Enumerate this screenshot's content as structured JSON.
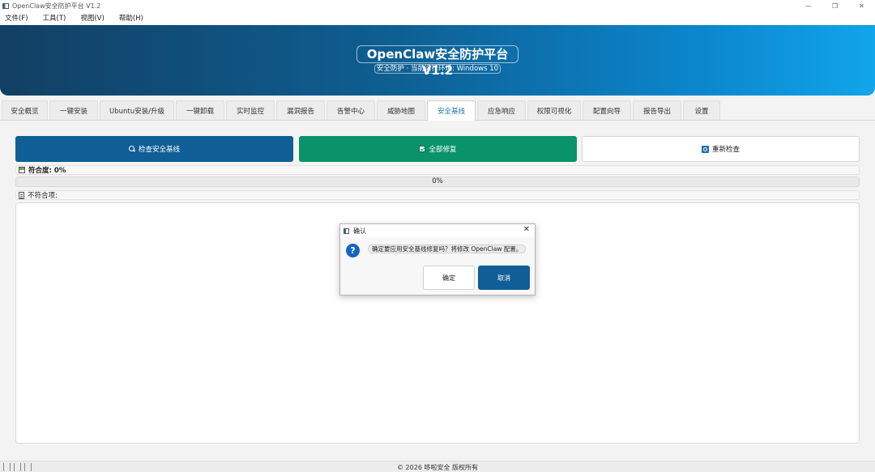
{
  "window": {
    "title": "OpenClaw安全防护平台 V1.2",
    "minimize": "—",
    "maximize": "❐",
    "close": "✕"
  },
  "menu": [
    "文件(F)",
    "工具(T)",
    "视图(V)",
    "帮助(H)"
  ],
  "banner": {
    "title": "OpenClaw安全防护平台 V1.2",
    "subtitle": "安全防护 · 当前运行环境: Windows 10"
  },
  "tabs": [
    {
      "label": "安全概览",
      "w": 57
    },
    {
      "label": "一键安装",
      "w": 60
    },
    {
      "label": "Ubuntu安装/升级",
      "w": 92
    },
    {
      "label": "一键卸载",
      "w": 60
    },
    {
      "label": "实时监控",
      "w": 60
    },
    {
      "label": "漏洞报告",
      "w": 60
    },
    {
      "label": "告警中心",
      "w": 60
    },
    {
      "label": "威胁地图",
      "w": 60
    },
    {
      "label": "安全基线",
      "w": 60,
      "active": true
    },
    {
      "label": "应急响应",
      "w": 60
    },
    {
      "label": "权限可视化",
      "w": 66
    },
    {
      "label": "配置向导",
      "w": 60
    },
    {
      "label": "报告导出",
      "w": 60
    },
    {
      "label": "设置",
      "w": 46
    }
  ],
  "actions": {
    "check": "检查安全基线",
    "fix": "全部修复",
    "recheck": "重新检查"
  },
  "compliance": {
    "label": "符合度: 0%",
    "progress_text": "0%",
    "progress_value": 0
  },
  "noncompliant": {
    "label": "不符合项:"
  },
  "dialog": {
    "title": "确认",
    "message": "确定要应用安全基线修复吗？将修改 OpenClaw 配置。",
    "ok": "确定",
    "cancel": "取消",
    "icon": "?"
  },
  "status": {
    "copyright": "© 2026 哆啦安全 版权所有"
  },
  "colors": {
    "accent": "#0f5f96",
    "success": "#0a936b",
    "active_tab": "#1f6fb0"
  }
}
